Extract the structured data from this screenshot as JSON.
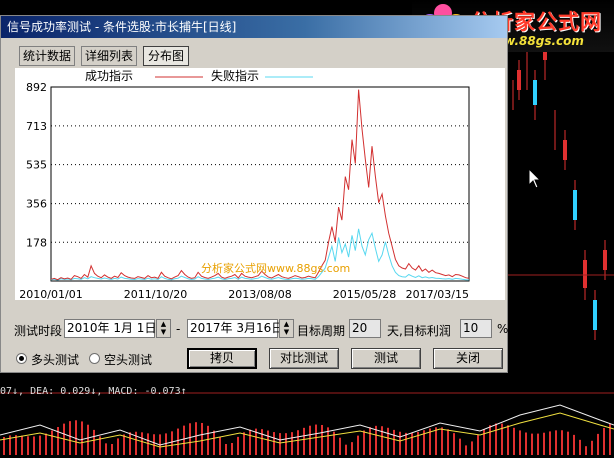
{
  "window": {
    "title": "信号成功率测试 - 条件选股:市长捕牛[日线]"
  },
  "logo": {
    "brand": "分析家公式网",
    "url": "www.88gs.com"
  },
  "tabs": [
    {
      "label": "统计数据",
      "active": false
    },
    {
      "label": "详细列表",
      "active": false
    },
    {
      "label": "分布图",
      "active": true
    }
  ],
  "chart_data": {
    "type": "line",
    "legend": [
      "成功指示",
      "失败指示"
    ],
    "legend_placement": "top-center",
    "colors": {
      "success": "#d23030",
      "fail": "#58d8f0"
    },
    "yticks": [
      892,
      713,
      535,
      356,
      178
    ],
    "ylim": [
      0,
      892
    ],
    "xticks": [
      "2010/01/01",
      "2011/10/20",
      "2013/08/08",
      "2015/05/28",
      "2017/03/15"
    ],
    "grid": true,
    "watermark": "分析家公式网www.88gs.com",
    "series": [
      {
        "name": "成功指示",
        "values": [
          8,
          12,
          6,
          15,
          10,
          14,
          8,
          25,
          20,
          12,
          30,
          18,
          70,
          35,
          22,
          15,
          28,
          18,
          12,
          22,
          16,
          38,
          25,
          18,
          14,
          12,
          20,
          16,
          12,
          25,
          15,
          18,
          12,
          40,
          22,
          15,
          10,
          18,
          25,
          48,
          30,
          18,
          12,
          15,
          40,
          22,
          16,
          12,
          18,
          25,
          35,
          18,
          12,
          18,
          22,
          30,
          14,
          35,
          22,
          18,
          15,
          20,
          25,
          45,
          30,
          18,
          14,
          22,
          30,
          20,
          15,
          12,
          18,
          25,
          20,
          14,
          16,
          22,
          18,
          15,
          40,
          70,
          95,
          180,
          250,
          180,
          340,
          280,
          480,
          420,
          650,
          540,
          880,
          700,
          560,
          430,
          620,
          480,
          360,
          400,
          300,
          220,
          160,
          100,
          70,
          60,
          55,
          80,
          60,
          50,
          70,
          45,
          55,
          40,
          50,
          38,
          35,
          30,
          25,
          28,
          20,
          30,
          28,
          22,
          15,
          12
        ]
      },
      {
        "name": "失败指示",
        "values": [
          5,
          8,
          4,
          10,
          7,
          9,
          6,
          12,
          10,
          8,
          15,
          10,
          20,
          15,
          12,
          9,
          14,
          10,
          7,
          12,
          9,
          18,
          12,
          10,
          8,
          7,
          11,
          9,
          7,
          13,
          8,
          10,
          7,
          20,
          12,
          8,
          6,
          10,
          13,
          22,
          16,
          10,
          7,
          9,
          20,
          12,
          9,
          7,
          10,
          13,
          18,
          10,
          7,
          10,
          12,
          16,
          8,
          18,
          12,
          10,
          8,
          11,
          13,
          22,
          16,
          10,
          8,
          12,
          16,
          11,
          8,
          7,
          10,
          13,
          11,
          8,
          9,
          12,
          10,
          8,
          20,
          40,
          60,
          110,
          160,
          90,
          200,
          130,
          170,
          110,
          210,
          140,
          240,
          160,
          120,
          190,
          220,
          150,
          90,
          120,
          180,
          120,
          70,
          40,
          25,
          20,
          18,
          30,
          22,
          16,
          24,
          15,
          19,
          14,
          16,
          13,
          12,
          10,
          9,
          11,
          8,
          12,
          10,
          8,
          6,
          5
        ]
      }
    ]
  },
  "controls": {
    "period_label": "测试时段",
    "start_date": "2010年 1月 1日",
    "dash": "-",
    "end_date": "2017年 3月16日",
    "target_period_label": "目标周期",
    "target_period": "20",
    "days_label": "天,目标利润",
    "target_profit": "10",
    "percent": "%",
    "radio_long": "多头测试",
    "radio_short": "空头测试",
    "radio_long_selected": true
  },
  "buttons": {
    "copy": "拷贝",
    "compare": "对比测试",
    "test": "测试",
    "close": "关闭"
  },
  "indicator": {
    "text": "07↓, DEA: 0.029↓, MACD: -0.073↑"
  }
}
